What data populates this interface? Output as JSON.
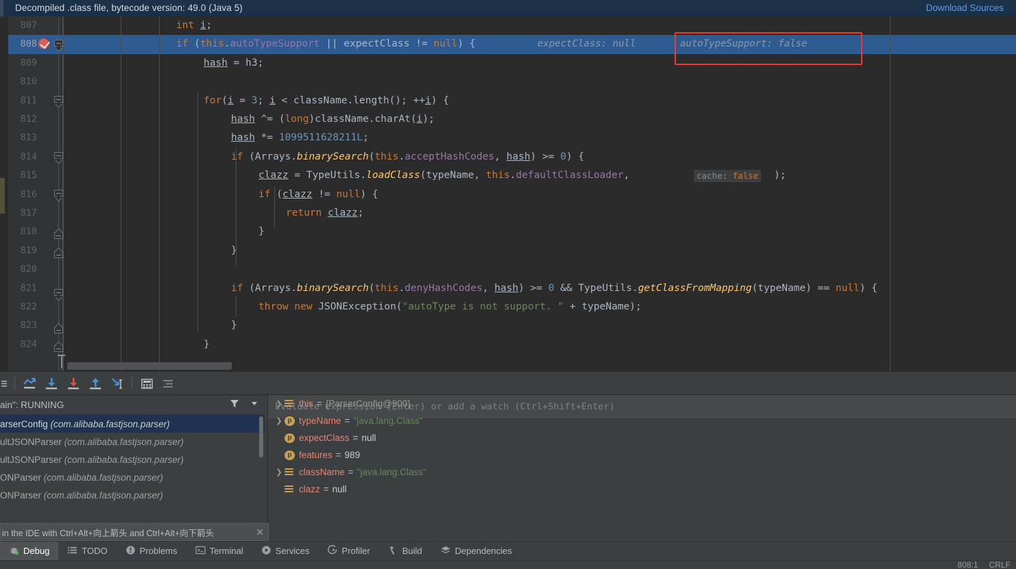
{
  "notice": {
    "text": "Decompiled .class file, bytecode version: 49.0 (Java 5)",
    "link": "Download Sources"
  },
  "editor": {
    "first_line": 807,
    "highlight_line": 808,
    "lines": [
      {
        "n": "807",
        "indent": 0
      },
      {
        "n": "808",
        "indent": 0
      },
      {
        "n": "809",
        "indent": 0
      },
      {
        "n": "810",
        "indent": 0
      },
      {
        "n": "811",
        "indent": 0
      },
      {
        "n": "812",
        "indent": 0
      },
      {
        "n": "813",
        "indent": 0
      },
      {
        "n": "814",
        "indent": 0
      },
      {
        "n": "815",
        "indent": 0
      },
      {
        "n": "816",
        "indent": 0
      },
      {
        "n": "817",
        "indent": 0
      },
      {
        "n": "818",
        "indent": 0
      },
      {
        "n": "819",
        "indent": 0
      },
      {
        "n": "820",
        "indent": 0
      },
      {
        "n": "821",
        "indent": 0
      },
      {
        "n": "822",
        "indent": 0
      },
      {
        "n": "823",
        "indent": 0
      },
      {
        "n": "824",
        "indent": 0
      }
    ],
    "inline_hints": {
      "expect_class": "expectClass: null",
      "auto_type_support": "autoTypeSupport: false",
      "cache_param_name": "cache:",
      "cache_param_value": "false"
    },
    "code_text": {
      "l807": "int i;",
      "l808": "if (this.autoTypeSupport || expectClass != null) {",
      "l809": "hash = h3;",
      "l811": "for(i = 3; i < className.length(); ++i) {",
      "l812": "hash ^= (long)className.charAt(i);",
      "l813": "hash *= 1099511628211L;",
      "l814": "if (Arrays.binarySearch(this.acceptHashCodes, hash) >= 0) {",
      "l815": "clazz = TypeUtils.loadClass(typeName, this.defaultClassLoader, false);",
      "l816": "if (clazz != null) {",
      "l817": "return clazz;",
      "l818": "}",
      "l819": "}",
      "l821": "if (Arrays.binarySearch(this.denyHashCodes, hash) >= 0 && TypeUtils.getClassFromMapping(typeName) == null) {",
      "l822": "throw new JSONException(\"autoType is not support. \" + typeName);",
      "l823": "}",
      "l824": "}"
    }
  },
  "debug_toolbar": {
    "items": [
      {
        "name": "step-over-icon",
        "tooltip": "Step Over"
      },
      {
        "name": "step-into-icon",
        "tooltip": "Step Into"
      },
      {
        "name": "force-step-into-icon",
        "tooltip": "Force Step Into"
      },
      {
        "name": "step-out-icon",
        "tooltip": "Step Out"
      },
      {
        "name": "run-to-cursor-icon",
        "tooltip": "Run to Cursor"
      },
      {
        "name": "evaluate-expression-icon",
        "tooltip": "Evaluate Expression"
      },
      {
        "name": "show-execution-point-icon",
        "tooltip": "Show Execution Point"
      }
    ]
  },
  "frames": {
    "thread_status": "ain\": RUNNING",
    "rows": [
      {
        "method": "arserConfig",
        "pkg": "(com.alibaba.fastjson.parser)",
        "selected": true
      },
      {
        "method": "ultJSONParser",
        "pkg": "(com.alibaba.fastjson.parser)",
        "selected": false
      },
      {
        "method": "ultJSONParser",
        "pkg": "(com.alibaba.fastjson.parser)",
        "selected": false
      },
      {
        "method": "ONParser",
        "pkg": "(com.alibaba.fastjson.parser)",
        "selected": false
      },
      {
        "method": "ONParser",
        "pkg": "(com.alibaba.fastjson.parser)",
        "selected": false
      }
    ]
  },
  "variables": {
    "evaluate_placeholder": "Evaluate expression (Enter) or add a watch (Ctrl+Shift+Enter)",
    "rows": [
      {
        "expand": true,
        "icon": "field",
        "name": "this",
        "value": "{ParserConfig@900}",
        "kind": "obj"
      },
      {
        "expand": true,
        "icon": "parameter",
        "name": "typeName",
        "value": "\"java.lang.Class\"",
        "kind": "str"
      },
      {
        "expand": false,
        "icon": "parameter",
        "name": "expectClass",
        "value": "null",
        "kind": "null"
      },
      {
        "expand": false,
        "icon": "parameter",
        "name": "features",
        "value": "989",
        "kind": "num"
      },
      {
        "expand": true,
        "icon": "field",
        "name": "className",
        "value": "\"java.lang.Class\"",
        "kind": "str"
      },
      {
        "expand": false,
        "icon": "field",
        "name": "clazz",
        "value": "null",
        "kind": "null"
      }
    ],
    "param_badge_letter": "p"
  },
  "hint_balloon": {
    "text": "in the IDE with Ctrl+Alt+向上箭头 and Ctrl+Alt+向下箭头",
    "close": "✕"
  },
  "bottom_tabs": [
    {
      "label": "Debug",
      "icon": "bug-icon",
      "active": true
    },
    {
      "label": "TODO",
      "icon": "list-icon",
      "active": false
    },
    {
      "label": "Problems",
      "icon": "warning-icon",
      "active": false
    },
    {
      "label": "Terminal",
      "icon": "terminal-icon",
      "active": false
    },
    {
      "label": "Services",
      "icon": "play-circle-icon",
      "active": false
    },
    {
      "label": "Profiler",
      "icon": "profiler-icon",
      "active": false
    },
    {
      "label": "Build",
      "icon": "hammer-icon",
      "active": false
    },
    {
      "label": "Dependencies",
      "icon": "layers-icon",
      "active": false
    }
  ],
  "status_bar": {
    "caret": "808:1",
    "line_sep": "CRLF"
  },
  "colors": {
    "highlight_line": "#2f5b93",
    "notice_bg": "#1b3147",
    "link": "#589df6",
    "annotation_box": "#f03a2e",
    "breakpoint": "#db5c5c"
  }
}
